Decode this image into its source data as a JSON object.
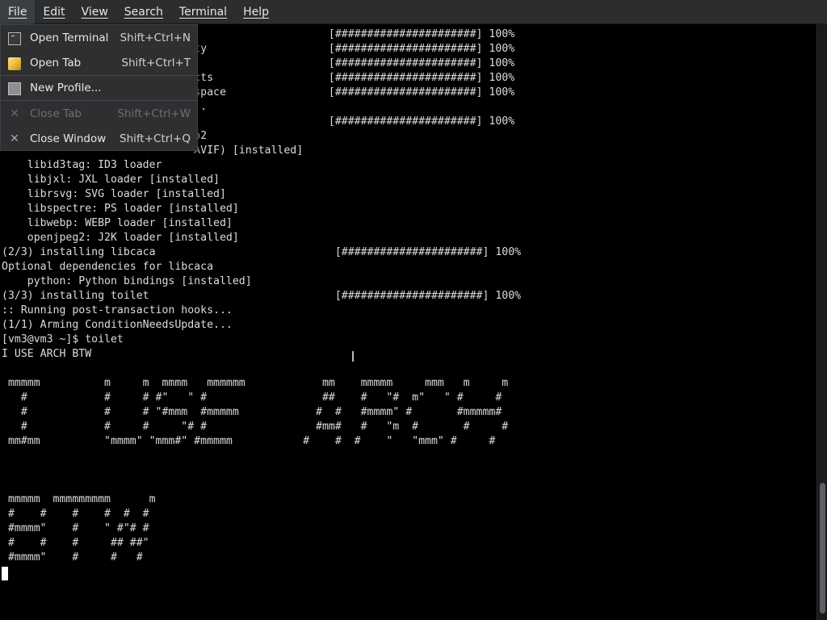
{
  "menubar": {
    "items": [
      "File",
      "Edit",
      "View",
      "Search",
      "Terminal",
      "Help"
    ]
  },
  "file_menu": {
    "open_terminal": {
      "label": "Open Terminal",
      "accel": "Shift+Ctrl+N",
      "icon": "terminal-icon"
    },
    "open_tab": {
      "label": "Open Tab",
      "accel": "Shift+Ctrl+T",
      "icon": "tab-icon"
    },
    "new_profile": {
      "label": "New Profile...",
      "icon": "profile-icon"
    },
    "close_tab": {
      "label": "Close Tab",
      "accel": "Shift+Ctrl+W",
      "icon": "close-icon",
      "disabled": true
    },
    "close_window": {
      "label": "Close Window",
      "accel": "Shift+Ctrl+Q",
      "icon": "close-icon"
    }
  },
  "terminal": {
    "lines": [
      "                                                   [######################] 100%",
      "                              ty                   [######################] 100%",
      "                                                   [######################] 100%",
      "                              cts                  [######################] 100%",
      "                              space                [######################] 100%",
      "                              ..",
      "                                                   [######################] 100%",
      "                              o2",
      "                              AVIF) [installed]",
      "    libid3tag: ID3 loader",
      "    libjxl: JXL loader [installed]",
      "    librsvg: SVG loader [installed]",
      "    libspectre: PS loader [installed]",
      "    libwebp: WEBP loader [installed]",
      "    openjpeg2: J2K loader [installed]",
      "(2/3) installing libcaca                            [######################] 100%",
      "Optional dependencies for libcaca",
      "    python: Python bindings [installed]",
      "(3/3) installing toilet                             [######################] 100%",
      ":: Running post-transaction hooks...",
      "(1/1) Arming ConditionNeedsUpdate...",
      "[vm3@vm3 ~]$ toilet",
      "I USE ARCH BTW",
      "",
      " mmmmm          m     m  mmmm   mmmmmm            mm    mmmmm     mmm   m     m",
      "   #            #     # #\"   \" #                  ##    #   \"#  m\"   \" #     #",
      "   #            #     # \"#mmm  #mmmmm            #  #   #mmmm\" #       #mmmmm#",
      "   #            #     #     \"# #                 #mm#   #   \"m  #       #     #",
      " mm#mm          \"mmmm\" \"mmm#\" #mmmmm           #    #  #    \"   \"mmm\" #     #",
      "",
      "",
      "",
      " mmmmm  mmmmmmmmm      m",
      " #    #    #    #  #  #",
      " #mmmm\"    #    \" #\"# #",
      " #    #    #     ## ##\"",
      " #mmmm\"    #     #   #"
    ]
  }
}
